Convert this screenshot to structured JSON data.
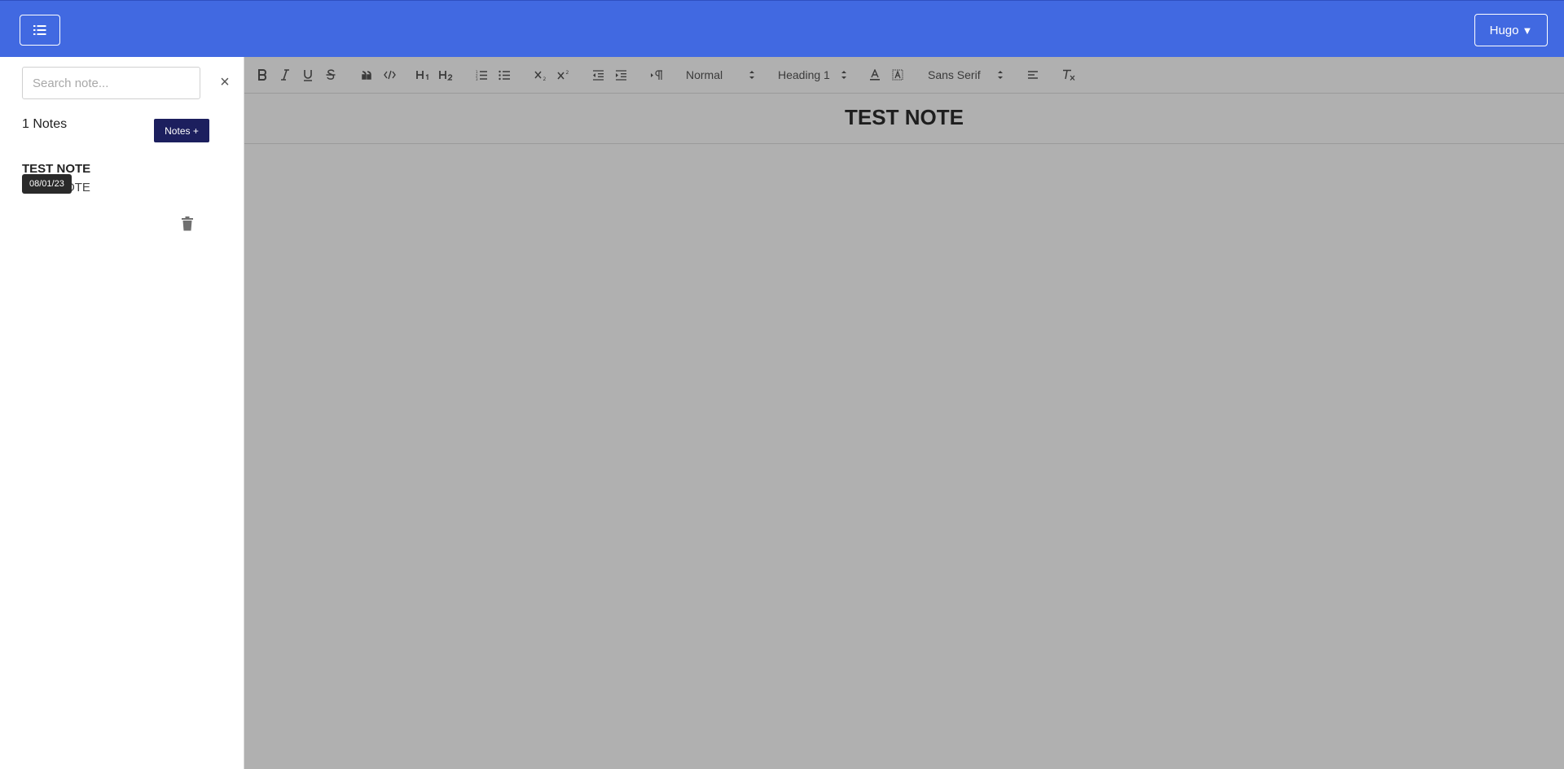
{
  "header": {
    "menu_icon": "list-icon",
    "user_name": "Hugo",
    "user_caret": "▼",
    "bar_color": "#4169e1"
  },
  "sidebar": {
    "search_placeholder": "Search note...",
    "clear_symbol": "×",
    "notes_count": "1 Notes",
    "new_note_label": "Notes +",
    "new_note_color": "#1c1f5e",
    "notes": [
      {
        "title": "TEST NOTE",
        "preview": "TEST NOTE",
        "date": "08/01/23"
      }
    ]
  },
  "toolbar": {
    "buttons": [
      "bold-icon",
      "italic-icon",
      "underline-icon",
      "strikethrough-icon",
      "blockquote-icon",
      "code-block-icon",
      "heading-1-icon",
      "heading-2-icon",
      "ordered-list-icon",
      "bullet-list-icon",
      "subscript-icon",
      "superscript-icon",
      "outdent-icon",
      "indent-icon",
      "text-direction-icon",
      "font-color-icon",
      "background-color-icon",
      "align-icon",
      "clear-format-icon"
    ],
    "size_select": "Normal",
    "header_select": "Heading 1",
    "font_select": "Sans Serif"
  },
  "editor": {
    "heading": "TEST NOTE",
    "background": "#b0b0b0"
  }
}
